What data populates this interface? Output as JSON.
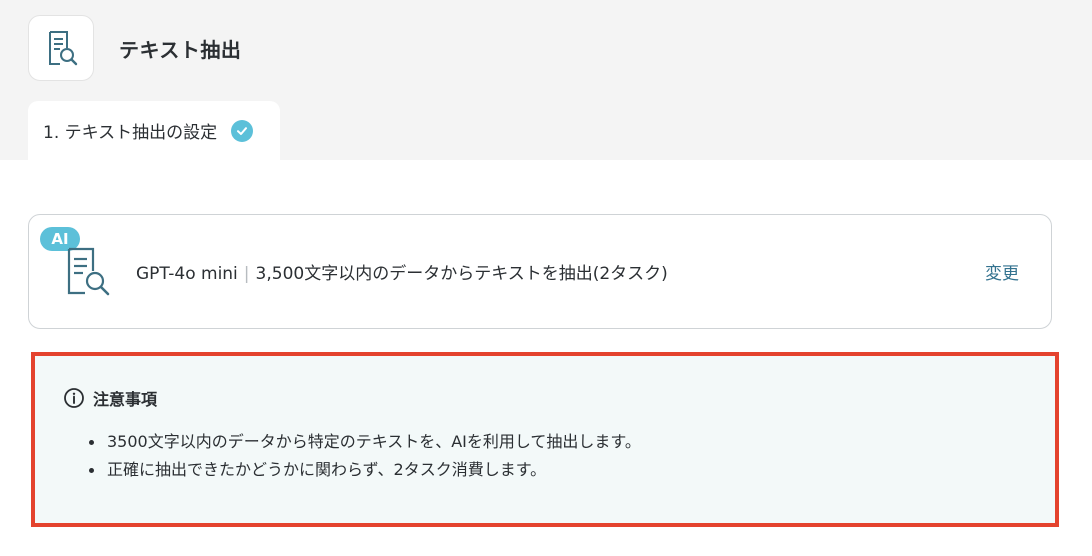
{
  "header": {
    "app_icon": "document-search-icon",
    "title": "テキスト抽出"
  },
  "tabs": [
    {
      "label": "1. テキスト抽出の設定",
      "status_icon": "check-circle-icon",
      "status_color": "#5cc0d9"
    }
  ],
  "action_card": {
    "badge": "AI",
    "badge_color": "#5cc0d9",
    "icon": "document-search-icon",
    "model": "GPT-4o mini",
    "separator": "|",
    "description": "3,500文字以内のデータからテキストを抽出(2タスク)",
    "change_label": "変更",
    "change_color": "#33728f"
  },
  "notice": {
    "icon": "info-circle-icon",
    "title": "注意事項",
    "border_color": "#e4432e",
    "items": [
      "3500文字以内のデータから特定のテキストを、AIを利用して抽出します。",
      "正確に抽出できたかどうかに関わらず、2タスク消費します。"
    ]
  }
}
